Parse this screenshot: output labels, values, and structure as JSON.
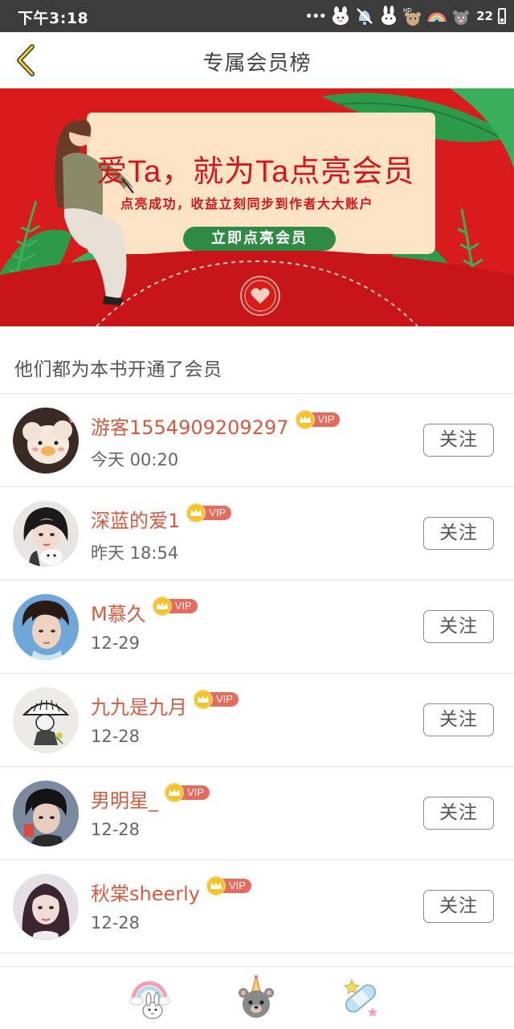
{
  "status_bar": {
    "time": "下午3:18",
    "dots": "•••",
    "battery": "22",
    "icons": [
      "rabbit-sticker-icon",
      "bell-off-sticker-icon",
      "rabbit-face-icon",
      "hd-bear-icon",
      "rainbow-signal-icon",
      "bear-wifi-icon"
    ]
  },
  "header": {
    "back_icon": "chevron-left-icon",
    "title": "专属会员榜"
  },
  "banner": {
    "headline": "爱Ta，就为Ta点亮会员",
    "subline": "点亮成功，收益立刻同步到作者大大账户",
    "cta": "立即点亮会员",
    "colors": {
      "background": "#d81c1c",
      "card": "#fde3c6",
      "cta": "#2f8a43"
    }
  },
  "section": {
    "title": "他们都为本书开通了会员"
  },
  "members": [
    {
      "name": "游客1554909209297",
      "date": "今天 00:20",
      "vip": "VIP",
      "follow": "关注",
      "avatar": "duck-doll-avatar"
    },
    {
      "name": "深蓝的爱1",
      "date": "昨天 18:54",
      "vip": "VIP",
      "follow": "关注",
      "avatar": "girl-with-cat-avatar"
    },
    {
      "name": "M慕久",
      "date": "12-29",
      "vip": "VIP",
      "follow": "关注",
      "avatar": "young-man-avatar"
    },
    {
      "name": "九九是九月",
      "date": "12-28",
      "vip": "VIP",
      "follow": "关注",
      "avatar": "straw-hat-sketch-avatar"
    },
    {
      "name": "男明星_",
      "date": "12-28",
      "vip": "VIP",
      "follow": "关注",
      "avatar": "dark-hair-boy-avatar"
    },
    {
      "name": "秋棠sheerly",
      "date": "12-28",
      "vip": "VIP",
      "follow": "关注",
      "avatar": "girl-portrait-avatar"
    }
  ],
  "bottom_bar": {
    "icons": [
      "rainbow-rabbit-icon",
      "party-bear-icon",
      "star-bandage-icon"
    ]
  },
  "colors": {
    "accent_name": "#d65a3d",
    "vip_tag": "#e86a5c",
    "vip_crown": "#f5c329"
  }
}
